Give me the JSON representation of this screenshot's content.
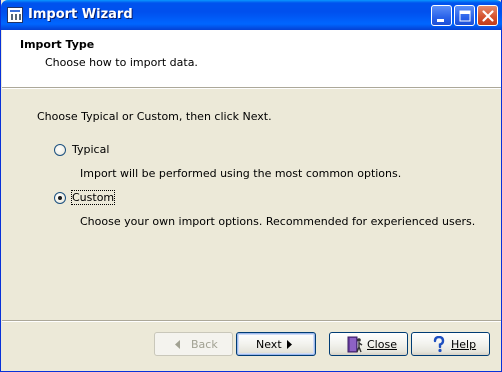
{
  "window": {
    "title": "Import Wizard",
    "app_icon": "wizard-app-icon",
    "controls": [
      "minimize-icon",
      "maximize-icon",
      "close-icon"
    ]
  },
  "header": {
    "title": "Import Type",
    "subtitle": "Choose how to import data."
  },
  "main": {
    "instruction": "Choose Typical or Custom, then click Next.",
    "options": [
      {
        "label": "Typical",
        "description": "Import will be performed using the most common options.",
        "selected": false
      },
      {
        "label": "Custom",
        "description": "Choose your own import options. Recommended for experienced users.",
        "selected": true
      }
    ]
  },
  "buttons": {
    "back": {
      "label": "Back",
      "icon": "arrow-left-icon",
      "enabled": false
    },
    "next": {
      "label": "Next",
      "icon": "arrow-right-icon",
      "enabled": true
    },
    "close": {
      "label": "Close",
      "icon": "door-exit-icon",
      "enabled": true
    },
    "help": {
      "label": "Help",
      "icon": "question-mark-icon",
      "enabled": true
    }
  }
}
